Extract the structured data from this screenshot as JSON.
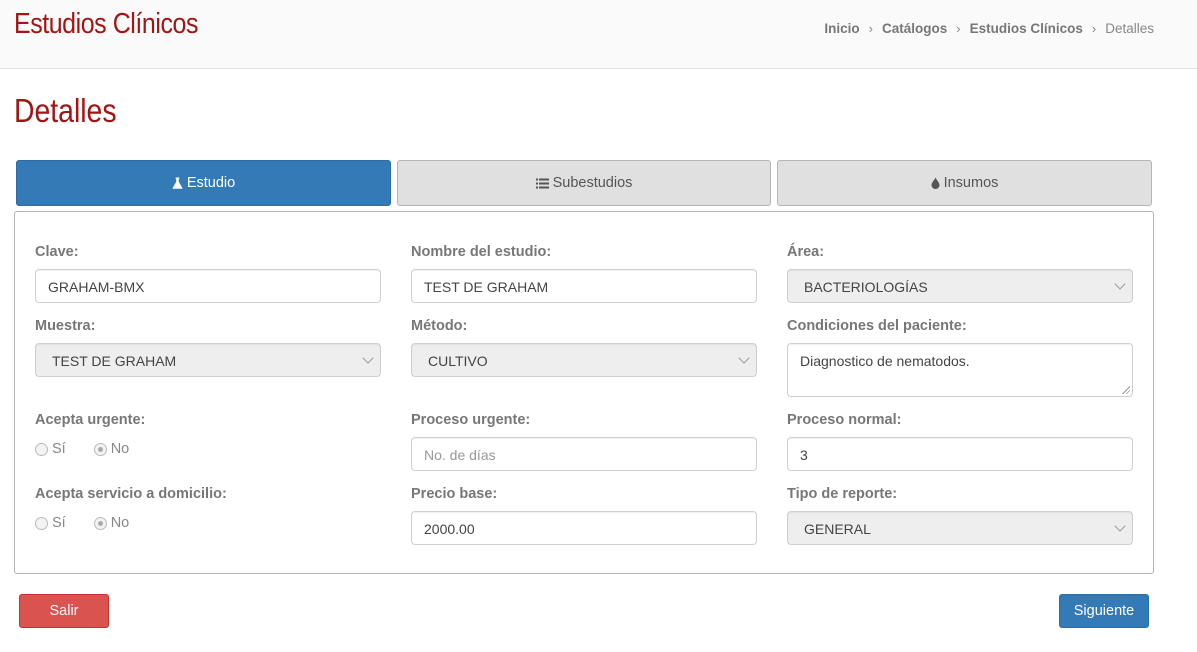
{
  "header": {
    "app_title": "Estudios Clínicos",
    "breadcrumb": [
      "Inicio",
      "Catálogos",
      "Estudios Clínicos",
      "Detalles"
    ],
    "separator": "›"
  },
  "page_title": "Detalles",
  "tabs": [
    {
      "label": "Estudio",
      "icon": "flask-icon",
      "active": true
    },
    {
      "label": "Subestudios",
      "icon": "list-icon",
      "active": false
    },
    {
      "label": "Insumos",
      "icon": "drop-icon",
      "active": false
    }
  ],
  "form": {
    "clave": {
      "label": "Clave:",
      "value": "GRAHAM-BMX"
    },
    "nombre": {
      "label": "Nombre del estudio:",
      "value": "TEST DE GRAHAM"
    },
    "area": {
      "label": "Área:",
      "value": "BACTERIOLOGÍAS"
    },
    "muestra": {
      "label": "Muestra:",
      "value": "TEST DE GRAHAM"
    },
    "metodo": {
      "label": "Método:",
      "value": "CULTIVO"
    },
    "condiciones": {
      "label": "Condiciones del paciente:",
      "value": "Diagnostico de nematodos."
    },
    "acepta_urgente": {
      "label": "Acepta urgente:",
      "options": [
        "Sí",
        "No"
      ],
      "selected": "No"
    },
    "proceso_urgente": {
      "label": "Proceso urgente:",
      "value": "",
      "placeholder": "No. de días"
    },
    "proceso_normal": {
      "label": "Proceso normal:",
      "value": "3"
    },
    "acepta_domicilio": {
      "label": "Acepta servicio a domicilio:",
      "options": [
        "Sí",
        "No"
      ],
      "selected": "No"
    },
    "precio_base": {
      "label": "Precio base:",
      "value": "2000.00"
    },
    "tipo_reporte": {
      "label": "Tipo de reporte:",
      "value": "GENERAL"
    }
  },
  "actions": {
    "exit_label": "Salir",
    "next_label": "Siguiente"
  },
  "colors": {
    "brand": "#a31515",
    "primary": "#337ab7",
    "danger": "#d9534f"
  }
}
